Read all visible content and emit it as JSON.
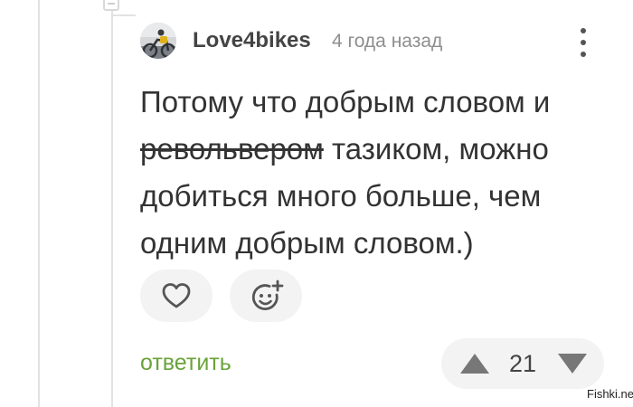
{
  "comment": {
    "author": "Love4bikes",
    "time": "4 года назад",
    "text": {
      "part1": "Потому что добрым словом и ",
      "strikethrough": "револьвером",
      "part2": " тазиком, можно добиться много больше, чем одним добрым словом.)"
    }
  },
  "actions": {
    "reply_label": "ответить",
    "like_icon": "heart-icon",
    "reaction_icon": "add-emoji-icon",
    "more_icon": "vertical-dots-icon"
  },
  "rating": {
    "value": "21",
    "up_icon": "triangle-up-icon",
    "down_icon": "triangle-down-icon"
  },
  "watermark": "Fishki.net",
  "colors": {
    "accent": "#6aa33a",
    "muted": "#8e8e8e",
    "button_bg": "#f3f3f3",
    "text": "#333333"
  }
}
